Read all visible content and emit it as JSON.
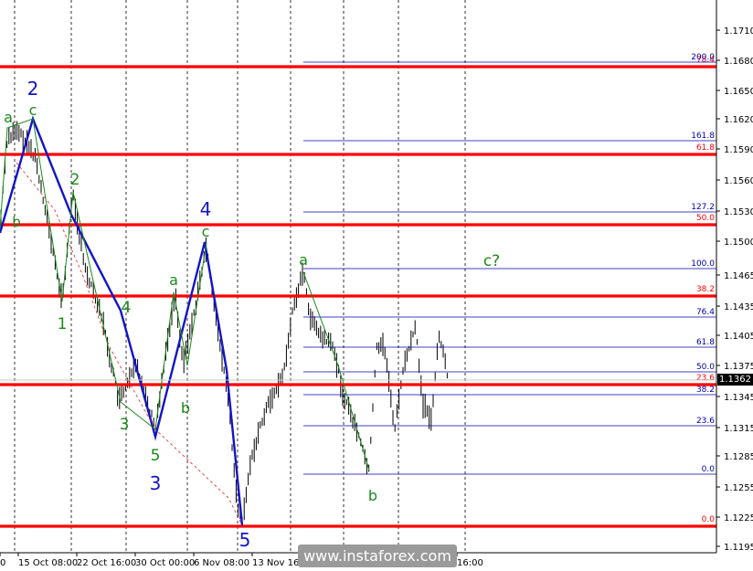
{
  "chart_data": {
    "type": "line",
    "title": "",
    "xlabel": "",
    "ylabel": "",
    "ylim": [
      1.119,
      1.1745
    ],
    "y_ticks": [
      "1.1710",
      "1.1680",
      "1.1650",
      "1.1620",
      "1.1590",
      "1.1560",
      "1.1530",
      "1.1500",
      "1.1465",
      "1.1435",
      "1.1405",
      "1.1375",
      "1.1345",
      "1.1315",
      "1.1285",
      "1.1255",
      "1.1225",
      "1.1195"
    ],
    "x_ticks": [
      "0",
      "15 Oct 08:00",
      "22 Oct 16:00",
      "30 Oct 00:00",
      "6 Nov 08:00",
      "13 Nov 16:00",
      "16:00"
    ],
    "current_price": "1.1362",
    "horizontal_levels_red": [
      1.1672,
      1.1587,
      1.1516,
      1.1445,
      1.1354,
      1.1219
    ],
    "fibonacci_upper": [
      {
        "label": "200.0",
        "value": 1.1677
      },
      {
        "label": "161.8",
        "value": 1.16
      },
      {
        "label": "127.2",
        "value": 1.1531
      },
      {
        "label": "100.0",
        "value": 1.1475
      },
      {
        "label": "76.4",
        "value": 1.1428
      },
      {
        "label": "61.8",
        "value": 1.1398
      },
      {
        "label": "50.0",
        "value": 1.1374
      },
      {
        "label": "38.2",
        "value": 1.135
      },
      {
        "label": "23.6",
        "value": 1.1321
      },
      {
        "label": "0.0",
        "value": 1.1267
      }
    ],
    "fibonacci_red_labels": [
      {
        "label": "78.4",
        "value": 1.1672
      },
      {
        "label": "61.8",
        "value": 1.1587
      },
      {
        "label": "50.0",
        "value": 1.1516
      },
      {
        "label": "38.2",
        "value": 1.1445
      },
      {
        "label": "23.6",
        "value": 1.1357
      },
      {
        "label": "0.0",
        "value": 1.1219
      }
    ],
    "wave_points": [
      {
        "label": "2",
        "value": 1.1625
      },
      {
        "label": "1",
        "value": 1.144
      },
      {
        "label": "2",
        "value": 1.155
      },
      {
        "label": "3",
        "value": 1.134
      },
      {
        "label": "4",
        "value": 1.144
      },
      {
        "label": "5",
        "value": 1.1305
      },
      {
        "label": "4",
        "value": 1.1498
      },
      {
        "label": "5",
        "value": 1.1215
      },
      {
        "label": "a",
        "value": 1.147
      },
      {
        "label": "b",
        "value": 1.1267
      },
      {
        "label": "c?",
        "value": 1.146
      }
    ],
    "wave_labels": [
      {
        "text": "2",
        "color": "#1414c8",
        "size": 20
      },
      {
        "text": "c",
        "color": "#1a8a1a",
        "size": 16
      },
      {
        "text": "a",
        "color": "#1a8a1a",
        "size": 16
      },
      {
        "text": "b",
        "color": "#1a8a1a",
        "size": 15
      },
      {
        "text": "2",
        "color": "#1a8a1a",
        "size": 17
      },
      {
        "text": "1",
        "color": "#1a8a1a",
        "size": 17
      },
      {
        "text": "4",
        "color": "#1a8a1a",
        "size": 17
      },
      {
        "text": "3",
        "color": "#1a8a1a",
        "size": 17
      },
      {
        "text": "5",
        "color": "#1a8a1a",
        "size": 17
      },
      {
        "text": "3",
        "color": "#1414c8",
        "size": 20
      },
      {
        "text": "a",
        "color": "#1a8a1a",
        "size": 16
      },
      {
        "text": "b",
        "color": "#1a8a1a",
        "size": 16
      },
      {
        "text": "4",
        "color": "#1414c8",
        "size": 20
      },
      {
        "text": "c",
        "color": "#1a8a1a",
        "size": 16
      },
      {
        "text": "5",
        "color": "#1414c8",
        "size": 20
      },
      {
        "text": "a",
        "color": "#1a8a1a",
        "size": 16
      },
      {
        "text": "b",
        "color": "#1a8a1a",
        "size": 16
      },
      {
        "text": "c?",
        "color": "#1a8a1a",
        "size": 17
      }
    ],
    "grid": "vertical dashed",
    "colors": {
      "support_resistance": "#ff0000",
      "fibonacci": "#0000aa",
      "wave_line": "#1414c8",
      "sub_wave_line": "#1a8a1a",
      "candles": "#000000"
    }
  },
  "watermark": "www.instaforex.com"
}
